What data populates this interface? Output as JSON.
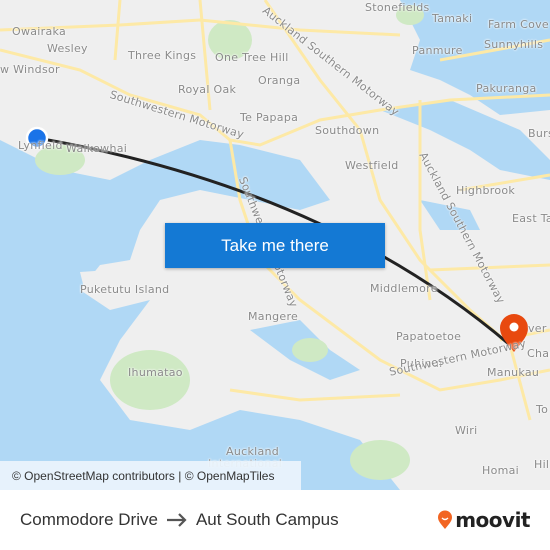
{
  "map": {
    "labels": [
      "Owairaka",
      "Wesley",
      "Three Kings",
      "One Tree Hill",
      "Auckland Southern Motorway",
      "Stonefields",
      "Tamaki",
      "Farm Cove",
      "Panmure",
      "Sunnyhills",
      "w Windsor",
      "Royal Oak",
      "Oranga",
      "Pakuranga",
      "Southwestern Motorway",
      "Te Papapa",
      "Southdown",
      "Burs",
      "Lynfield",
      "Waikowhai",
      "Westfield",
      "Highbrook",
      "Southwestern Motorway",
      "Auckland Southern Motorway",
      "East Ta",
      "Puketutu Island",
      "Middlemore",
      "Mangere",
      "Papatoetoe",
      "ver P",
      "Ihumatao",
      "Puhinui",
      "Chap",
      "Manukau",
      "Southwestern Motorway",
      "Wiri",
      "Auckland",
      "International",
      "Homai",
      "Hil",
      "To"
    ],
    "colors": {
      "water": "#b0d8f5",
      "land": "#efefef",
      "park": "#cfe9c4",
      "road": "#fde9a6",
      "route": "#222222",
      "origin": "#1a73e8",
      "destination": "#e8490f",
      "button": "#1479d4"
    }
  },
  "cta": {
    "label": "Take me there"
  },
  "attribution": "© OpenStreetMap contributors | © OpenMapTiles",
  "footer": {
    "origin": "Commodore Drive",
    "arrow_icon": "arrow-right-icon",
    "destination": "Aut South Campus",
    "brand": "moovit"
  }
}
